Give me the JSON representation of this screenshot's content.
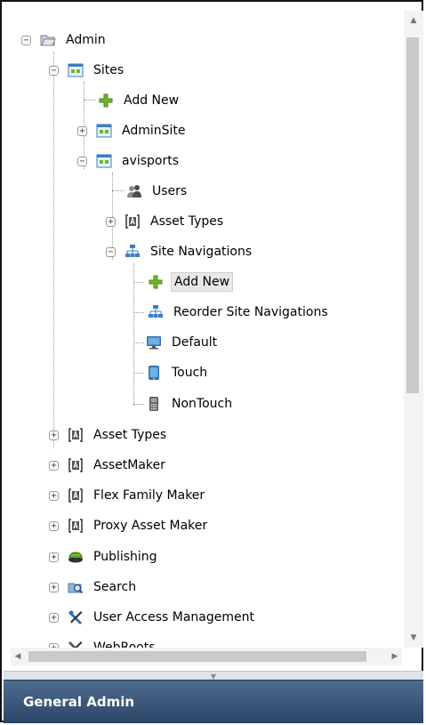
{
  "tree": [
    {
      "label": "Admin",
      "icon": "folder-open-icon",
      "toggle": "−"
    },
    {
      "label": "Sites",
      "icon": "sites-icon",
      "toggle": "−"
    },
    {
      "label": "Add New",
      "icon": "plus-icon"
    },
    {
      "label": "AdminSite",
      "icon": "sites-icon",
      "toggle": "+"
    },
    {
      "label": "avisports",
      "icon": "sites-icon",
      "toggle": "−"
    },
    {
      "label": "Users",
      "icon": "users-icon"
    },
    {
      "label": "Asset Types",
      "icon": "asset-type-icon",
      "toggle": "+"
    },
    {
      "label": "Site Navigations",
      "icon": "sitemap-icon",
      "toggle": "−"
    },
    {
      "label": "Add New",
      "icon": "plus-icon",
      "selected": true
    },
    {
      "label": "Reorder Site Navigations",
      "icon": "sitemap-icon"
    },
    {
      "label": "Default",
      "icon": "monitor-icon"
    },
    {
      "label": "Touch",
      "icon": "tablet-icon"
    },
    {
      "label": "NonTouch",
      "icon": "phone-icon"
    },
    {
      "label": "Asset Types",
      "icon": "asset-type-icon",
      "toggle": "+"
    },
    {
      "label": "AssetMaker",
      "icon": "asset-type-icon",
      "toggle": "+"
    },
    {
      "label": "Flex Family Maker",
      "icon": "asset-type-icon",
      "toggle": "+"
    },
    {
      "label": "Proxy Asset Maker",
      "icon": "asset-type-icon",
      "toggle": "+"
    },
    {
      "label": "Publishing",
      "icon": "publishing-icon",
      "toggle": "+"
    },
    {
      "label": "Search",
      "icon": "search-icon",
      "toggle": "+"
    },
    {
      "label": "User Access Management",
      "icon": "tools-icon",
      "toggle": "+"
    },
    {
      "label": "WebRoots",
      "icon": "tools-icon",
      "toggle": "+"
    }
  ],
  "footer": {
    "title": "General Admin"
  },
  "colors": {
    "footer_top": "#4f6b8e",
    "footer_bottom": "#2b4667",
    "plus_green": "#6fb52c"
  }
}
